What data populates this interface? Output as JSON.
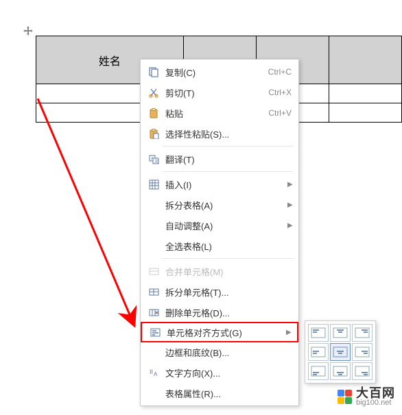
{
  "table": {
    "header": "姓名"
  },
  "menu": {
    "copy": {
      "label": "复制(C)",
      "shortcut": "Ctrl+C"
    },
    "cut": {
      "label": "剪切(T)",
      "shortcut": "Ctrl+X"
    },
    "paste": {
      "label": "粘贴",
      "shortcut": "Ctrl+V"
    },
    "paste_special": {
      "label": "选择性粘贴(S)..."
    },
    "translate": {
      "label": "翻译(T)"
    },
    "insert": {
      "label": "插入(I)"
    },
    "split_table": {
      "label": "拆分表格(A)"
    },
    "autofit": {
      "label": "自动调整(A)"
    },
    "select_all_table": {
      "label": "全选表格(L)"
    },
    "merge_cells": {
      "label": "合并单元格(M)"
    },
    "split_cells": {
      "label": "拆分单元格(T)..."
    },
    "delete_cells": {
      "label": "删除单元格(D)..."
    },
    "cell_align": {
      "label": "单元格对齐方式(G)"
    },
    "borders": {
      "label": "边框和底纹(B)..."
    },
    "text_dir": {
      "label": "文字方向(X)..."
    },
    "table_props": {
      "label": "表格属性(R)..."
    }
  },
  "watermark": {
    "name": "大百网",
    "domain": "big100.net"
  },
  "colors": {
    "logo": [
      "#4285f4",
      "#ea4335",
      "#fbbc05",
      "#34a853"
    ]
  }
}
